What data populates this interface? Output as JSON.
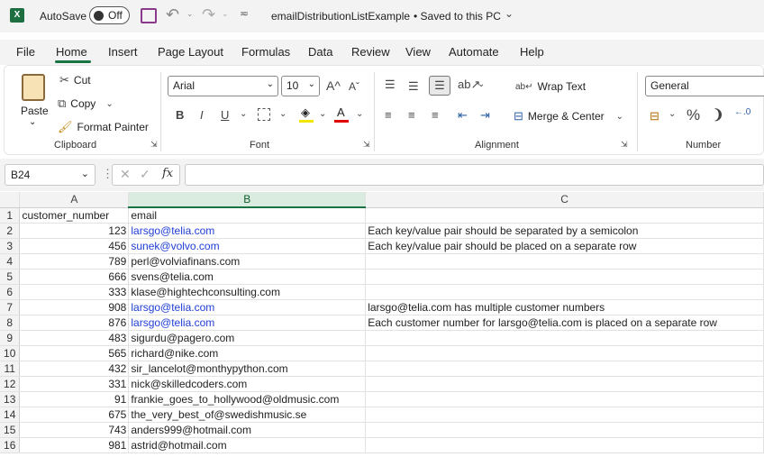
{
  "titlebar": {
    "autosave_label": "AutoSave",
    "autosave_state": "Off",
    "filename": "emailDistributionListExample",
    "save_status": "• Saved to this PC"
  },
  "menu": [
    "File",
    "Home",
    "Insert",
    "Page Layout",
    "Formulas",
    "Data",
    "Review",
    "View",
    "Automate",
    "Help"
  ],
  "ribbon": {
    "clipboard": {
      "group": "Clipboard",
      "paste": "Paste",
      "cut": "Cut",
      "copy": "Copy",
      "format_painter": "Format Painter"
    },
    "font": {
      "group": "Font",
      "font_name": "Arial",
      "font_size": "10",
      "bold": "B",
      "italic": "I",
      "underline": "U"
    },
    "alignment": {
      "group": "Alignment",
      "wrap_text": "Wrap Text",
      "merge_center": "Merge & Center"
    },
    "number": {
      "group": "Number",
      "format": "General",
      "percent": "%",
      "comma": "❩"
    }
  },
  "formula_bar": {
    "name_box": "B24",
    "fx": "fx",
    "value": ""
  },
  "columns": [
    "A",
    "B",
    "C"
  ],
  "rows": [
    {
      "n": "1",
      "a": "customer_number",
      "b": "email",
      "c": "",
      "link": false
    },
    {
      "n": "2",
      "a": "123",
      "b": "larsgo@telia.com",
      "c": "Each key/value pair should be separated by a semicolon",
      "link": true
    },
    {
      "n": "3",
      "a": "456",
      "b": "sunek@volvo.com",
      "c": "Each key/value pair should be placed on a separate row",
      "link": true
    },
    {
      "n": "4",
      "a": "789",
      "b": "perl@volviafinans.com",
      "c": "",
      "link": false
    },
    {
      "n": "5",
      "a": "666",
      "b": "svens@telia.com",
      "c": "",
      "link": false
    },
    {
      "n": "6",
      "a": "333",
      "b": "klase@hightechconsulting.com",
      "c": "",
      "link": false
    },
    {
      "n": "7",
      "a": "908",
      "b": "larsgo@telia.com",
      "c": "larsgo@telia.com has multiple customer numbers",
      "link": true
    },
    {
      "n": "8",
      "a": "876",
      "b": "larsgo@telia.com",
      "c": "Each customer number for larsgo@telia.com is placed on a separate row",
      "link": true
    },
    {
      "n": "9",
      "a": "483",
      "b": "sigurdu@pagero.com",
      "c": "",
      "link": false
    },
    {
      "n": "10",
      "a": "565",
      "b": "richard@nike.com",
      "c": "",
      "link": false
    },
    {
      "n": "11",
      "a": "432",
      "b": "sir_lancelot@monthypython.com",
      "c": "",
      "link": false
    },
    {
      "n": "12",
      "a": "331",
      "b": "nick@skilledcoders.com",
      "c": "",
      "link": false
    },
    {
      "n": "13",
      "a": "91",
      "b": "frankie_goes_to_hollywood@oldmusic.com",
      "c": "",
      "link": false
    },
    {
      "n": "14",
      "a": "675",
      "b": "the_very_best_of@swedishmusic.se",
      "c": "",
      "link": false
    },
    {
      "n": "15",
      "a": "743",
      "b": "anders999@hotmail.com",
      "c": "",
      "link": false
    },
    {
      "n": "16",
      "a": "981",
      "b": "astrid@hotmail.com",
      "c": "",
      "link": false
    }
  ]
}
